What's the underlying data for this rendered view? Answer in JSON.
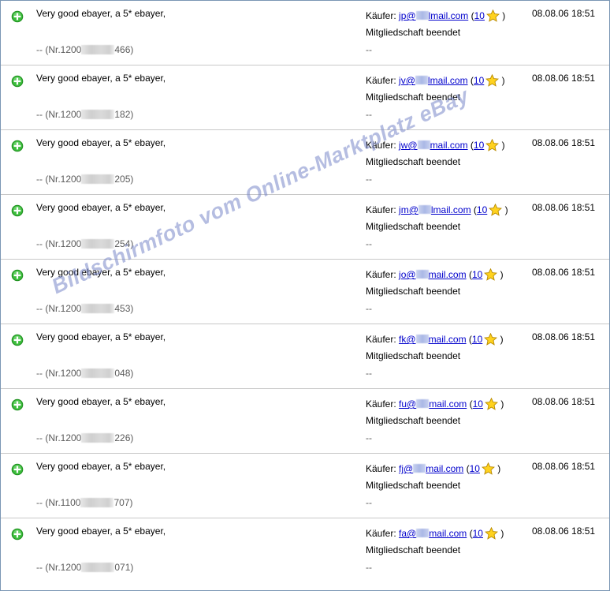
{
  "feedback": [
    {
      "comment": "Very good ebayer, a 5* ebayer,",
      "order_prefix": "-- (Nr.1200",
      "order_suffix": "466)",
      "buyer_label": "Käufer:",
      "email_user": "jp@",
      "email_domain": "lmail.com",
      "score_open": "(",
      "score": "10",
      "score_close": ")",
      "status": "Mitgliedschaft beendet",
      "extra": "--",
      "date": "08.08.06 18:51"
    },
    {
      "comment": "Very good ebayer, a 5* ebayer,",
      "order_prefix": "-- (Nr.1200",
      "order_suffix": "182)",
      "buyer_label": "Käufer:",
      "email_user": "jv@",
      "email_domain": "lmail.com",
      "score_open": "(",
      "score": "10",
      "score_close": ")",
      "status": "Mitgliedschaft beendet",
      "extra": "--",
      "date": "08.08.06 18:51"
    },
    {
      "comment": "Very good ebayer, a 5* ebayer,",
      "order_prefix": "-- (Nr.1200",
      "order_suffix": "205)",
      "buyer_label": "Käufer:",
      "email_user": "jw@",
      "email_domain": "mail.com",
      "score_open": "(",
      "score": "10",
      "score_close": ")",
      "status": "Mitgliedschaft beendet",
      "extra": "--",
      "date": "08.08.06 18:51"
    },
    {
      "comment": "Very good ebayer, a 5* ebayer,",
      "order_prefix": "-- (Nr.1200",
      "order_suffix": "254)",
      "buyer_label": "Käufer:",
      "email_user": "jm@",
      "email_domain": "lmail.com",
      "score_open": "(",
      "score": "10",
      "score_close": ")",
      "status": "Mitgliedschaft beendet",
      "extra": "--",
      "date": "08.08.06 18:51"
    },
    {
      "comment": "Very good ebayer, a 5* ebayer,",
      "order_prefix": "-- (Nr.1200",
      "order_suffix": "453)",
      "buyer_label": "Käufer:",
      "email_user": "jo@",
      "email_domain": "mail.com",
      "score_open": "(",
      "score": "10",
      "score_close": ")",
      "status": "Mitgliedschaft beendet",
      "extra": "--",
      "date": "08.08.06 18:51"
    },
    {
      "comment": "Very good ebayer, a 5* ebayer,",
      "order_prefix": "-- (Nr.1200",
      "order_suffix": "048)",
      "buyer_label": "Käufer:",
      "email_user": "fk@",
      "email_domain": "mail.com",
      "score_open": "(",
      "score": "10",
      "score_close": ")",
      "status": "Mitgliedschaft beendet",
      "extra": "--",
      "date": "08.08.06 18:51"
    },
    {
      "comment": "Very good ebayer, a 5* ebayer,",
      "order_prefix": "-- (Nr.1200",
      "order_suffix": "226)",
      "buyer_label": "Käufer:",
      "email_user": "fu@",
      "email_domain": "mail.com",
      "score_open": "(",
      "score": "10",
      "score_close": ")",
      "status": "Mitgliedschaft beendet",
      "extra": "--",
      "date": "08.08.06 18:51"
    },
    {
      "comment": "Very good ebayer, a 5* ebayer,",
      "order_prefix": "-- (Nr.1100",
      "order_suffix": "707)",
      "buyer_label": "Käufer:",
      "email_user": "fj@",
      "email_domain": "mail.com",
      "score_open": "(",
      "score": "10",
      "score_close": ")",
      "status": "Mitgliedschaft beendet",
      "extra": "--",
      "date": "08.08.06 18:51"
    },
    {
      "comment": "Very good ebayer, a 5* ebayer,",
      "order_prefix": "-- (Nr.1200",
      "order_suffix": "071)",
      "buyer_label": "Käufer:",
      "email_user": "fa@",
      "email_domain": "mail.com",
      "score_open": "(",
      "score": "10",
      "score_close": ")",
      "status": "Mitgliedschaft beendet",
      "extra": "--",
      "date": "08.08.06 18:51"
    }
  ],
  "watermark": "Bildschirmfoto vom Online-Marktplatz eBay",
  "icons": {
    "rating": "positive-plus-icon",
    "score": "star-icon"
  },
  "colors": {
    "positive": "#2fa52f",
    "link": "#0000cc",
    "star": "#ffd21e",
    "watermark": "#7887c8"
  }
}
